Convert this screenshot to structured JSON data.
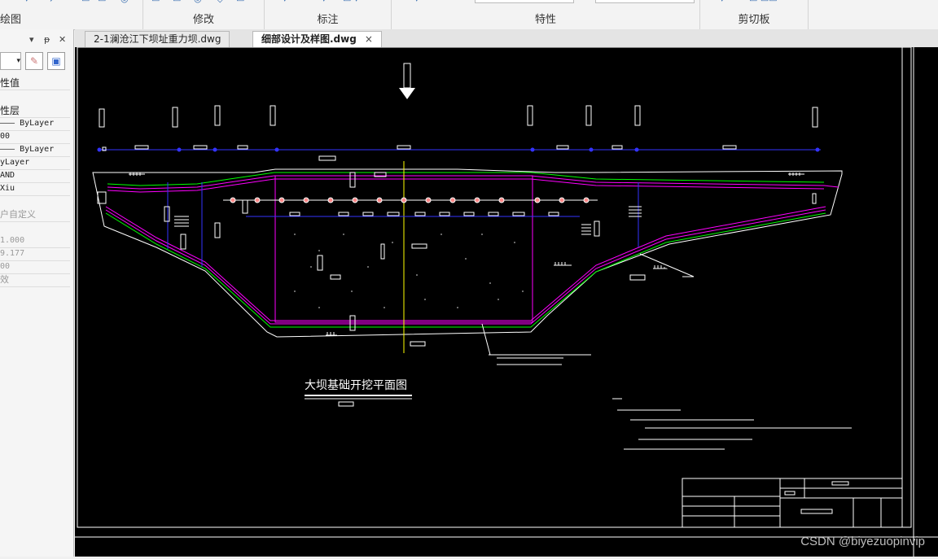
{
  "ribbon": {
    "groups": [
      {
        "label": "绘图"
      },
      {
        "label": "修改"
      },
      {
        "label": "标注"
      },
      {
        "label": "特性"
      },
      {
        "label": "剪切板"
      }
    ]
  },
  "properties_panel": {
    "header_label": "性值",
    "rows": [
      {
        "text": "性层"
      },
      {
        "text": "——— ByLayer"
      },
      {
        "text": "00"
      },
      {
        "text": "——— ByLayer"
      },
      {
        "text": "yLayer"
      },
      {
        "text": "AND"
      },
      {
        "text": "Xiu"
      },
      {
        "text": "户自定义"
      },
      {
        "text": "1.000"
      },
      {
        "text": "9.177"
      },
      {
        "text": "00"
      },
      {
        "text": "效"
      }
    ]
  },
  "tabs": [
    {
      "label": "2-1澜沧江下坝址重力坝.dwg",
      "active": false
    },
    {
      "label": "细部设计及样图.dwg",
      "active": true,
      "close": "×"
    }
  ],
  "drawing": {
    "plan_title": "大坝基础开挖平面图"
  },
  "watermark": "CSDN @biyezuopinvip",
  "colors": {
    "canvas_bg": "#000000",
    "line_white": "#ffffff",
    "line_magenta": "#ff00ff",
    "line_blue": "#0000ff",
    "line_green": "#00ff00",
    "line_yellow": "#ffff00"
  }
}
